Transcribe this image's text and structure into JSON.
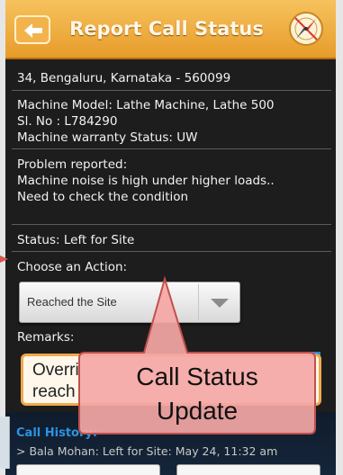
{
  "header": {
    "title": "Report Call Status",
    "back_icon": "back-arrow-icon",
    "logo_icon": "compass-icon"
  },
  "details": {
    "address": "34, Bengaluru, Karnataka - 560099",
    "machine_model": "Machine Model: Lathe Machine, Lathe 500",
    "serial_no": "Sl. No : L784290",
    "warranty_status": "Machine warranty Status: UW",
    "problem_label": "Problem reported:",
    "problem_line1": "Machine noise is high under higher loads..",
    "problem_line2": "Need to check the condition",
    "status": "Status: Left for Site"
  },
  "action": {
    "label": "Choose an Action:",
    "selected": "Reached the Site",
    "arrow_icon": "chevron-down-icon"
  },
  "remarks": {
    "label": "Remarks:",
    "line1": "Overri",
    "line2": "reach"
  },
  "history": {
    "title": "Call History:",
    "items": [
      "> Bala Mohan: Left for Site: May 24, 11:32 am"
    ]
  },
  "callout": {
    "line1": "Call Status",
    "line2": "Update"
  },
  "colors": {
    "header": "#f0ad45",
    "callout_fill": "#f4a7a5",
    "callout_border": "#c0504d",
    "history_title": "#2b93e3"
  }
}
